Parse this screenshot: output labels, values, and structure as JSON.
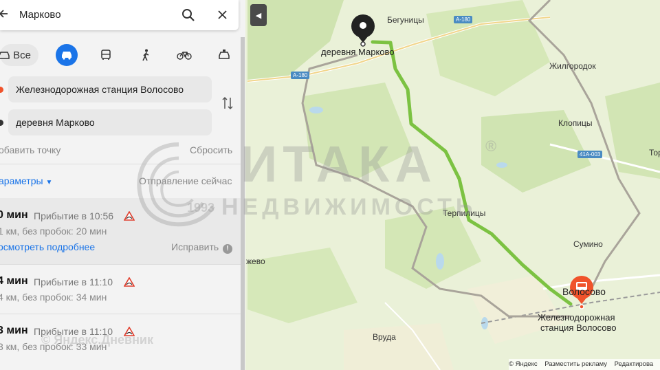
{
  "search": {
    "value": "Марково"
  },
  "modes": {
    "all_label": "Все"
  },
  "route_points": {
    "from": "Железнодорожная станция Волосово",
    "to": "деревня Марково",
    "add_point": "обавить точку",
    "reset": "Сбросить"
  },
  "params": {
    "label": "араметры",
    "departure": "Отправление сейчас"
  },
  "routes": [
    {
      "time": "0 мин",
      "arrival": "Прибытие в 10:56",
      "sub": "1 км, без пробок: 20 мин"
    },
    {
      "time": "4 мин",
      "arrival": "Прибытие в 11:10",
      "sub": "4 км, без пробок: 34 мин"
    },
    {
      "time": "3 мин",
      "arrival": "Прибытие в 11:10",
      "sub": "3 км, без пробок: 33 мин"
    }
  ],
  "route_details": {
    "more": "осмотреть подробнее",
    "fix": "Исправить"
  },
  "map": {
    "labels": {
      "marker_a": "деревня Марково",
      "marker_b_1": "Железнодорожная",
      "marker_b_2": "станция Волосово",
      "begunitsy": "Бегуницы",
      "zhilgorodok": "Жилгородок",
      "klopitsy": "Клопицы",
      "terpilitsy": "Терпилицы",
      "sumino": "Сумино",
      "volosovo": "Волосово",
      "vruda": "Вруда",
      "zhevo": "жево",
      "tor": "Тор",
      "road_a180_1": "А-180",
      "road_a180_2": "А-180",
      "road_41a003": "41А-003"
    }
  },
  "footer": {
    "yandex": "© Яндекс",
    "ads": "Разместить рекламу",
    "edit": "Редактирова"
  },
  "watermark": {
    "brand": "ИТАКА",
    "sub": "НЕДВИЖИМОСТЬ",
    "year": "1993",
    "reg": "®",
    "bottom": "© Яндекс.Дневник"
  },
  "colors": {
    "accent": "#1a74e8",
    "route": "#7cc242",
    "alt_route": "#a9a49a",
    "destination": "#f0532b",
    "map_bg": "#eaf1d8"
  }
}
